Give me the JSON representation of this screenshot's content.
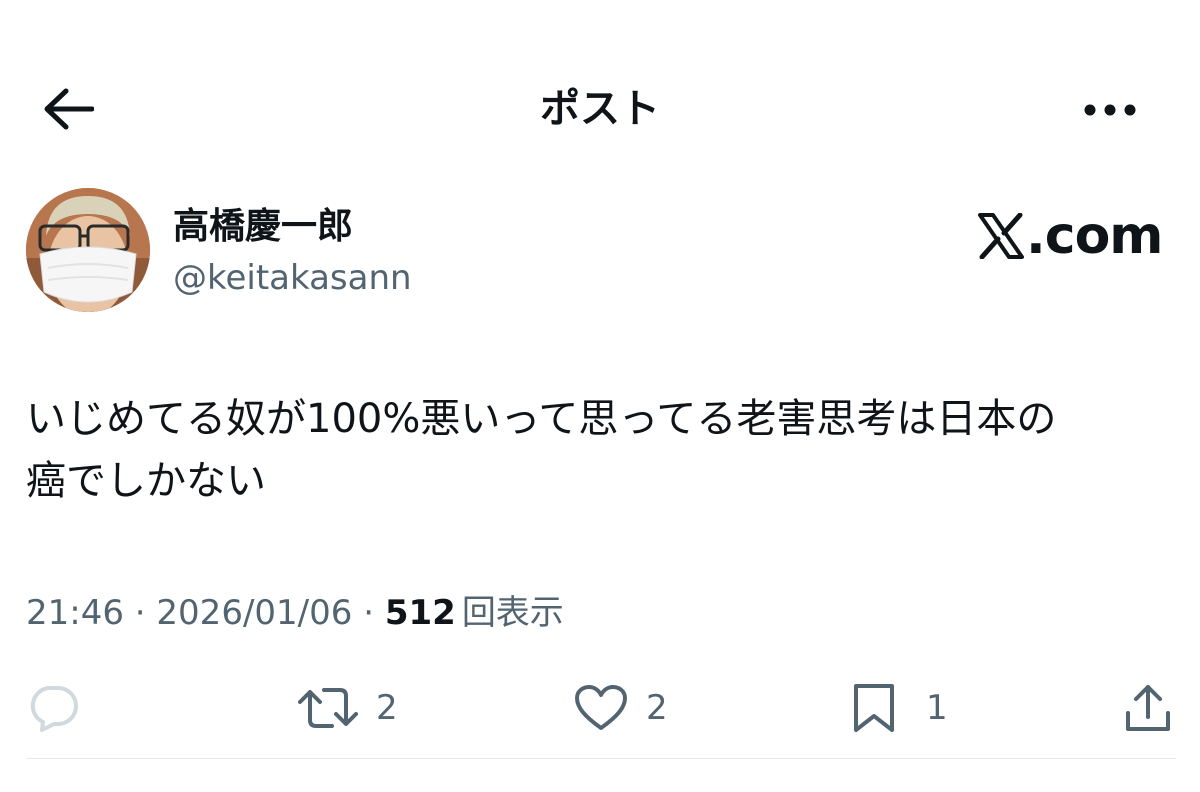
{
  "header": {
    "title": "ポスト"
  },
  "author": {
    "display_name": "高橋慶一郎",
    "handle": "@keitakasann"
  },
  "brand": {
    "logo_text": ".com"
  },
  "post": {
    "text_line1": "いじめてる奴が100%悪いって思ってる老害思考は日本の",
    "text_line2": "癌でしかない"
  },
  "meta": {
    "time": "21:46",
    "separator": " · ",
    "date": "2026/01/06",
    "views_count": "512",
    "views_label": "回表示"
  },
  "actions": {
    "retweets": "2",
    "likes": "2",
    "bookmarks": "1"
  },
  "colors": {
    "text": "#0f1419",
    "secondary": "#536471",
    "divider": "#e7e9ea",
    "reply_icon": "#cfd9de"
  },
  "icons": [
    "back-arrow-icon",
    "more-icon",
    "x-logo-icon",
    "reply-icon",
    "retweet-icon",
    "like-icon",
    "bookmark-icon",
    "share-icon"
  ]
}
